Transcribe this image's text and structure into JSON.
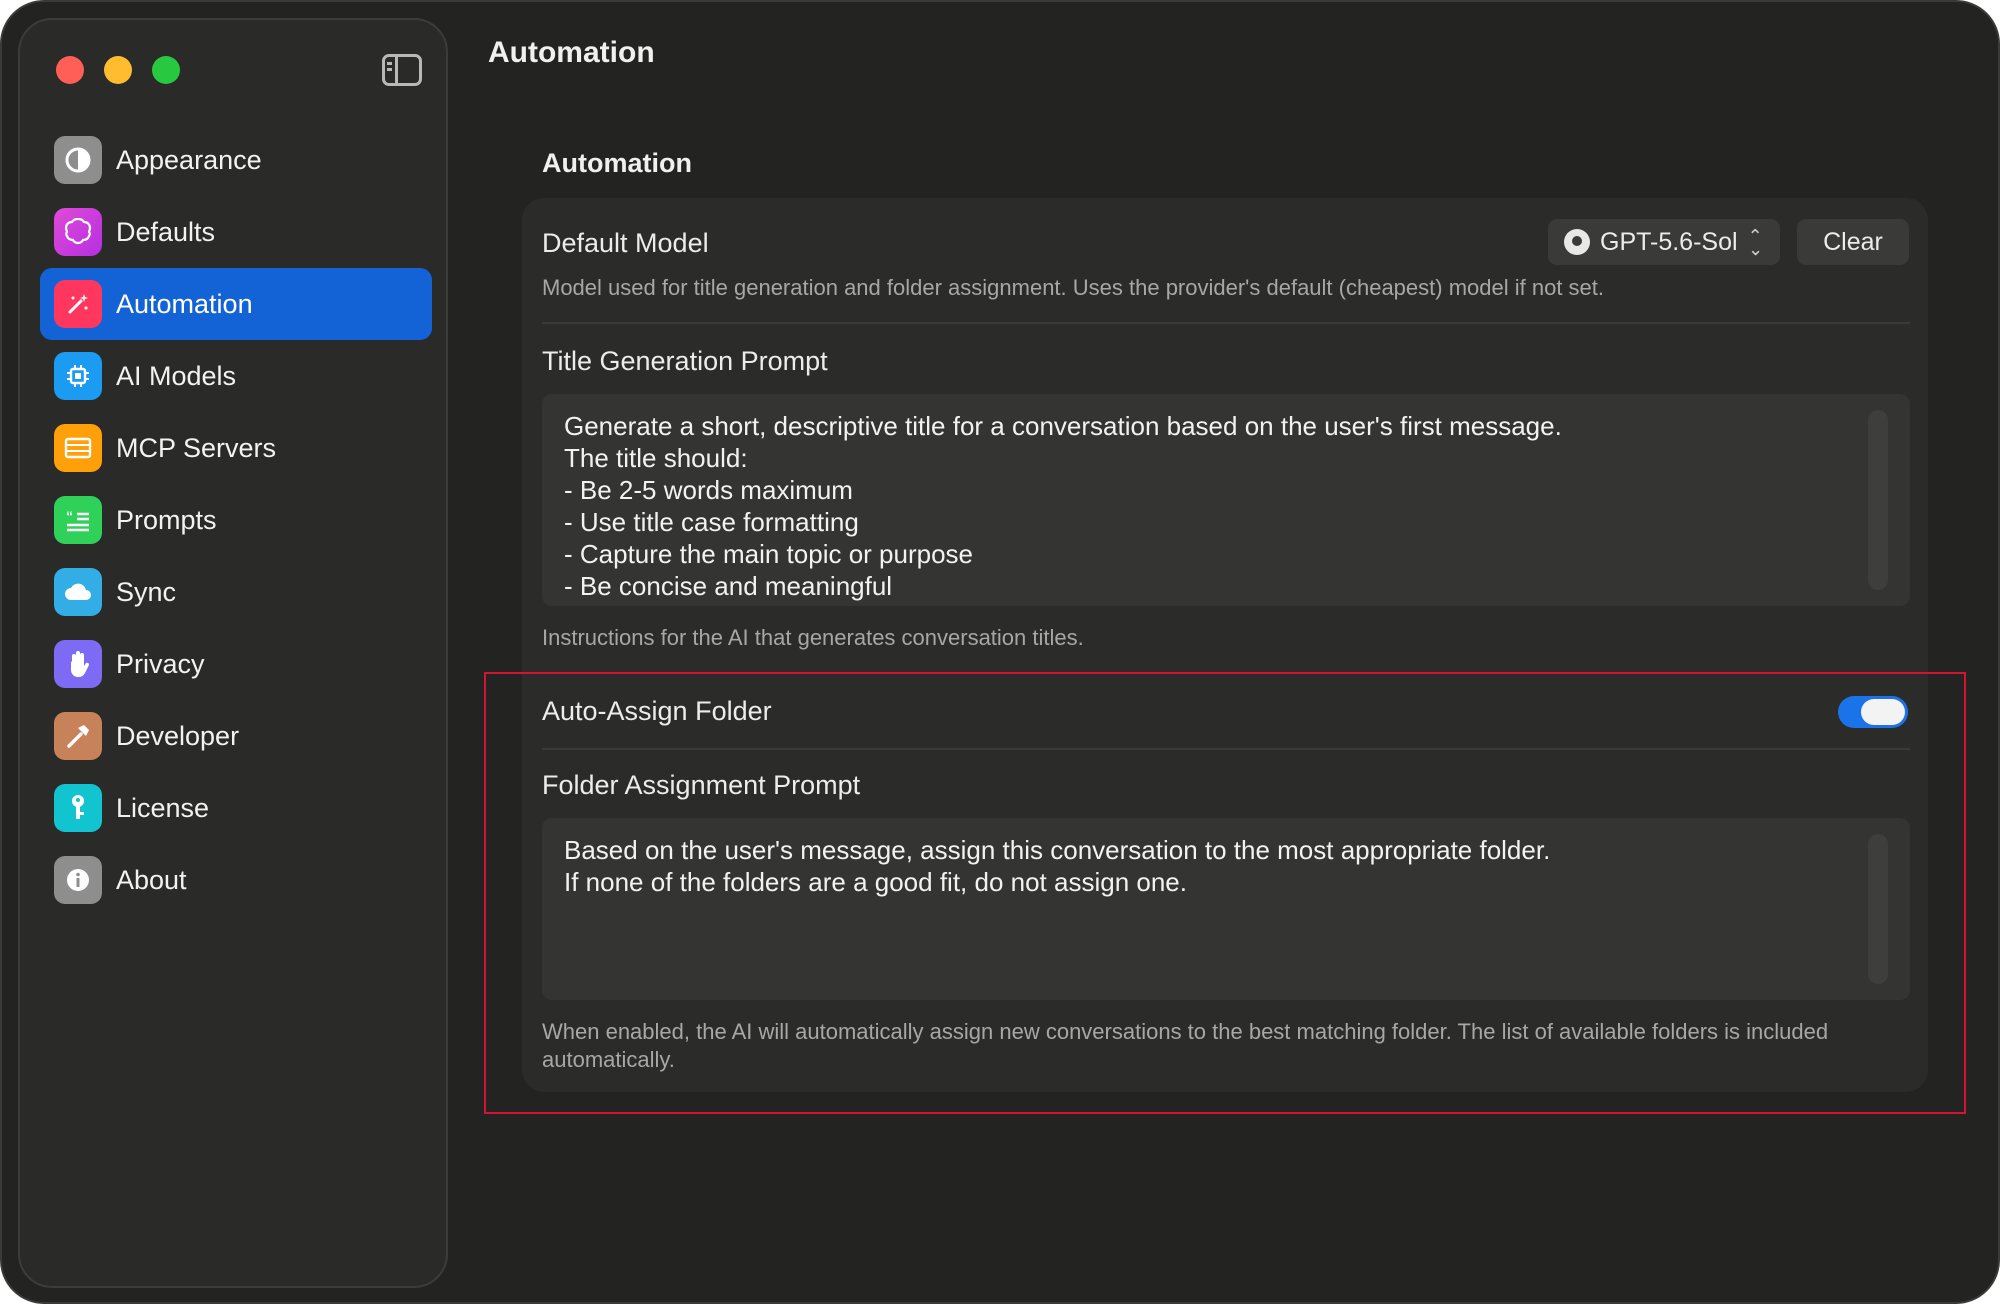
{
  "window": {
    "title": "Automation"
  },
  "sidebar": {
    "items": [
      {
        "label": "Appearance",
        "icon": "half-circle-icon",
        "color": "#8e8e8e"
      },
      {
        "label": "Defaults",
        "icon": "brain-icon",
        "color": "#d63ad9"
      },
      {
        "label": "Automation",
        "icon": "magic-wand-icon",
        "color": "#ff375f",
        "active": true
      },
      {
        "label": "AI Models",
        "icon": "cpu-icon",
        "color": "#1b9cf2"
      },
      {
        "label": "MCP Servers",
        "icon": "server-icon",
        "color": "#ff9f0a"
      },
      {
        "label": "Prompts",
        "icon": "quote-icon",
        "color": "#30d158"
      },
      {
        "label": "Sync",
        "icon": "cloud-icon",
        "color": "#32ade6"
      },
      {
        "label": "Privacy",
        "icon": "hand-icon",
        "color": "#7d6bf5"
      },
      {
        "label": "Developer",
        "icon": "hammer-icon",
        "color": "#c7825a"
      },
      {
        "label": "License",
        "icon": "key-icon",
        "color": "#12c4d0"
      },
      {
        "label": "About",
        "icon": "info-icon",
        "color": "#8e8e8e"
      }
    ]
  },
  "main": {
    "title": "Automation",
    "section_title": "Automation",
    "default_model": {
      "label": "Default Model",
      "selected": "GPT-5.6-Sol",
      "clear_label": "Clear",
      "description": "Model used for title generation and folder assignment. Uses the provider's default (cheapest) model if not set."
    },
    "title_prompt": {
      "label": "Title Generation Prompt",
      "value": "Generate a short, descriptive title for a conversation based on the user's first message.\nThe title should:\n- Be 2-5 words maximum\n- Use title case formatting\n- Capture the main topic or purpose\n- Be concise and meaningful",
      "description": "Instructions for the AI that generates conversation titles."
    },
    "auto_assign": {
      "label": "Auto-Assign Folder",
      "enabled": true
    },
    "folder_prompt": {
      "label": "Folder Assignment Prompt",
      "value": "Based on the user's message, assign this conversation to the most appropriate folder.\nIf none of the folders are a good fit, do not assign one.",
      "description": "When enabled, the AI will automatically assign new conversations to the best matching folder. The list of available folders is included automatically."
    }
  }
}
